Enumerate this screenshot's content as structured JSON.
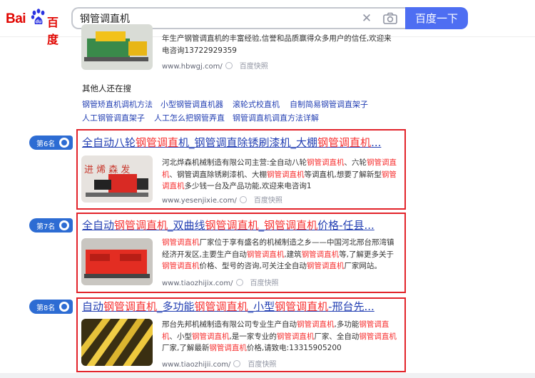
{
  "header": {
    "logo_text_a": "Bai",
    "logo_text_b": "百度",
    "query": "钢管调直机",
    "search_button": "百度一下",
    "colors": {
      "brand_red": "#e10601",
      "search_blue": "#4e6ef2",
      "badge_blue": "#2d6cd3",
      "highlight_red": "#f73131",
      "box_red": "#e2232a"
    },
    "icons": [
      "baidu-paw-icon",
      "clear-icon",
      "camera-icon"
    ]
  },
  "top_result": {
    "desc": "年生产钢管调直机的丰富经验,信誉和品质赢得众多用户的信任,欢迎来电咨询13722929359",
    "url": "www.hbwgj.com/",
    "snapshot": "百度快照"
  },
  "related": {
    "title": "其他人还在搜",
    "items": [
      "钢管矫直机调机方法",
      "小型钢管调直机器",
      "滚轮式校直机",
      "自制简易钢管调直架子",
      "人工钢管调直架子",
      "人工怎么把钢管弄直",
      "钢管调直机调直方法详解"
    ]
  },
  "results": [
    {
      "rank": "第6名",
      "title_parts": [
        "全自动八轮",
        "钢管调直",
        "机_钢管调直除锈刷漆机_大棚",
        "钢管调直机",
        "..."
      ],
      "desc_parts": [
        "河北烨森机械制造有限公司主营:全自动八轮",
        "钢管调直机",
        "、六轮",
        "钢管调直机",
        "、钢管调直除锈刷漆机、大棚",
        "钢管调直机",
        "等调直机,想要了解新型",
        "钢管调直机",
        "多少钱一台及产品功能,欢迎来电咨询1"
      ],
      "url": "www.yesenjixie.com/",
      "snapshot": "百度快照"
    },
    {
      "rank": "第7名",
      "title_parts": [
        "全自动",
        "钢管调直机",
        "_双曲线",
        "钢管调直机",
        "_",
        "钢管调直机",
        "价格-任县..."
      ],
      "desc_parts": [
        "",
        "钢管调直机",
        "厂家位于享有盛名的机械制造之乡——中国河北邢台邢湾镇经济开发区,主要生产自动",
        "钢管调直机",
        ",建筑",
        "钢管调直机",
        "等,了解更多关于",
        "钢管调直机",
        "价格、型号的咨询,可关注全自动",
        "钢管调直机",
        "厂家网站。"
      ],
      "url": "www.tiaozhijix.com/",
      "snapshot": "百度快照"
    },
    {
      "rank": "第8名",
      "title_parts": [
        "自动",
        "钢管调直机",
        "_多功能",
        "钢管调直机",
        "_小型",
        "钢管调直机",
        "-邢台先..."
      ],
      "desc_parts": [
        "邢台先邦机械制造有限公司专业生产自动",
        "钢管调直机",
        ",多功能",
        "钢管调直机",
        "、小型",
        "钢管调直机",
        ",是一家专业的",
        "钢管调直机",
        "厂家、全自动",
        "钢管调直机",
        "厂家,了解最新",
        "钢管调直机",
        "价格,请致电:13315905200"
      ],
      "url": "www.tiaozhijii.com/",
      "snapshot": "百度快照"
    }
  ]
}
